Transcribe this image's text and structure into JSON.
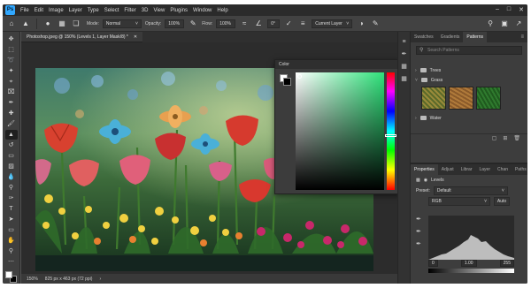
{
  "app": {
    "logo": "Ps",
    "menu": [
      "File",
      "Edit",
      "Image",
      "Layer",
      "Type",
      "Select",
      "Filter",
      "3D",
      "View",
      "Plugins",
      "Window",
      "Help"
    ]
  },
  "options": {
    "mode_label": "Normal",
    "opacity_label": "Opacity:",
    "opacity_value": "100%",
    "flow_label": "Flow:",
    "flow_value": "100%",
    "angle_value": "0°",
    "sample_value": "Current Layer"
  },
  "document": {
    "tab_title": "Photoshop.jpeg @ 150% (Levels 1, Layer Mask/8) *",
    "zoom": "150%",
    "doc_info": "825 px x 463 px (72 ppi)"
  },
  "color_picker": {
    "title": "Color"
  },
  "right_panel": {
    "tabs": [
      "Swatches",
      "Gradients",
      "Patterns"
    ],
    "active_tab": "Patterns",
    "search_placeholder": "Search Patterns",
    "groups": [
      "Trees",
      "Grass",
      "Water"
    ]
  },
  "properties": {
    "tabs": [
      "Properties",
      "Adjust",
      "Librar",
      "Layer",
      "Chan",
      "Paths"
    ],
    "adjustment": "Levels",
    "preset_label": "Preset:",
    "preset_value": "Default",
    "channel_value": "RGB",
    "auto_label": "Auto",
    "input_black": "0",
    "input_gamma": "1.00",
    "input_white": "255"
  },
  "colors": {
    "accent": "#31a8ff",
    "panel": "#3d3d3d",
    "canvas_bg": "#2c2c2c",
    "picker_green": "#2ee27a"
  },
  "icons": {
    "window_controls": [
      "minimize-icon",
      "maximize-icon",
      "close-icon"
    ],
    "tools": [
      "move-icon",
      "marquee-icon",
      "lasso-icon",
      "object-select-icon",
      "crop-icon",
      "frame-icon",
      "eyedropper-icon",
      "healing-icon",
      "brush-icon",
      "stamp-icon",
      "history-brush-icon",
      "eraser-icon",
      "gradient-icon",
      "blur-icon",
      "dodge-icon",
      "pen-icon",
      "type-icon",
      "path-select-icon",
      "shape-icon",
      "hand-icon",
      "zoom-icon",
      "more-icon"
    ]
  }
}
